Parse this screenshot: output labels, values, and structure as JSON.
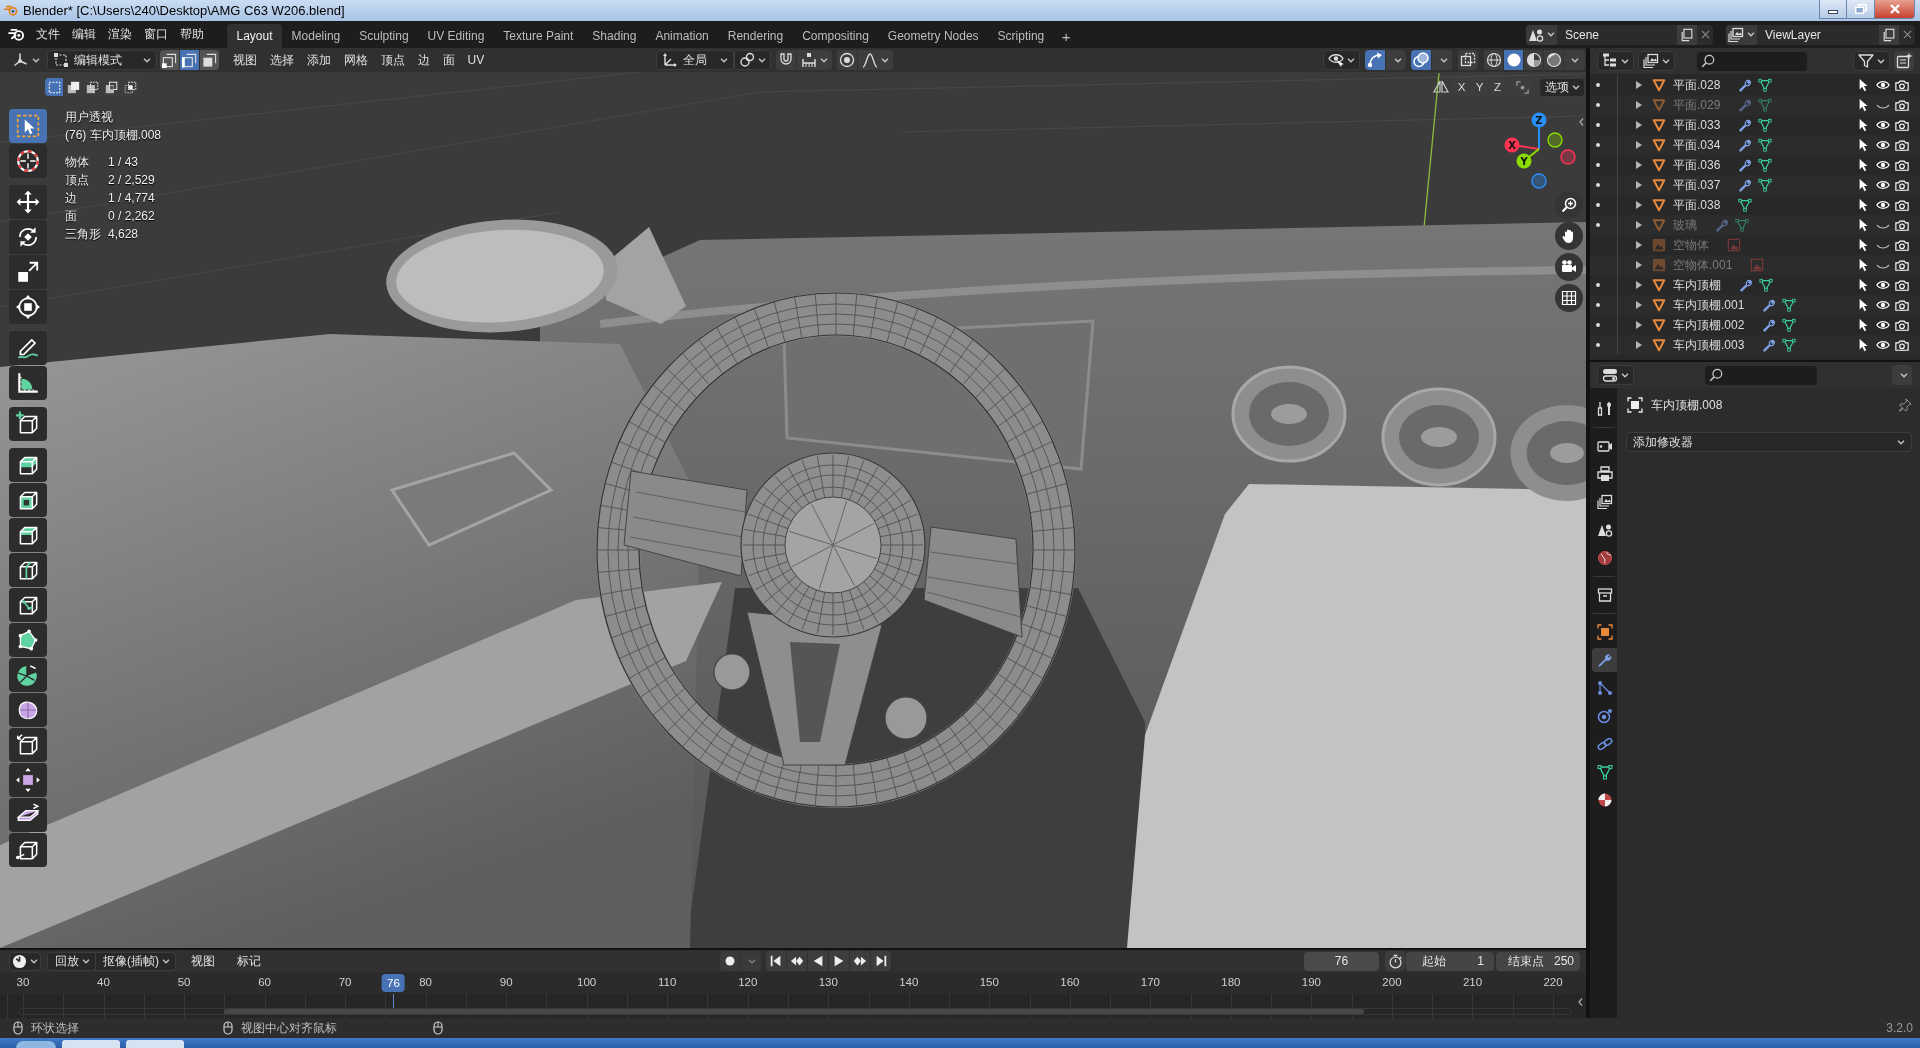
{
  "window": {
    "title": "Blender* [C:\\Users\\240\\Desktop\\AMG C63 W206.blend]"
  },
  "menu_bar": [
    "文件",
    "编辑",
    "渲染",
    "窗口",
    "帮助"
  ],
  "workspace_tabs": [
    {
      "label": "Layout",
      "selected": true
    },
    {
      "label": "Modeling",
      "selected": false
    },
    {
      "label": "Sculpting",
      "selected": false
    },
    {
      "label": "UV Editing",
      "selected": false
    },
    {
      "label": "Texture Paint",
      "selected": false
    },
    {
      "label": "Shading",
      "selected": false
    },
    {
      "label": "Animation",
      "selected": false
    },
    {
      "label": "Rendering",
      "selected": false
    },
    {
      "label": "Compositing",
      "selected": false
    },
    {
      "label": "Geometry Nodes",
      "selected": false
    },
    {
      "label": "Scripting",
      "selected": false
    }
  ],
  "add_workspace": "+",
  "scene": {
    "name": "Scene"
  },
  "view_layer": {
    "name": "ViewLayer"
  },
  "viewport_header": {
    "mode": "编辑模式",
    "select_modes": [
      {
        "kind": "vertex",
        "selected": false
      },
      {
        "kind": "edge",
        "selected": true
      },
      {
        "kind": "face",
        "selected": false
      }
    ],
    "menus": [
      "视图",
      "选择",
      "添加",
      "网格",
      "顶点",
      "边",
      "面",
      "UV"
    ],
    "orientation": "全局",
    "gizmos_on": true,
    "overlays_on": true,
    "shading_modes": [
      {
        "kind": "wireframe",
        "selected": false
      },
      {
        "kind": "solid",
        "selected": true
      },
      {
        "kind": "material",
        "selected": false
      },
      {
        "kind": "rendered",
        "selected": false
      }
    ]
  },
  "tool_settings": {
    "box_modes": [
      {
        "kind": "set",
        "selected": true
      },
      {
        "kind": "extend",
        "selected": false
      },
      {
        "kind": "subtract",
        "selected": false
      },
      {
        "kind": "invert",
        "selected": false
      },
      {
        "kind": "intersect",
        "selected": false
      }
    ],
    "mirror_axes": [
      "X",
      "Y",
      "Z"
    ],
    "options": "选项"
  },
  "viewport_info": {
    "view": "用户透视",
    "object": "(76) 车内顶棚.008",
    "stats": [
      {
        "label": "物体",
        "value": "1 / 43"
      },
      {
        "label": "顶点",
        "value": "2 / 2,529"
      },
      {
        "label": "边",
        "value": "1 / 4,774"
      },
      {
        "label": "面",
        "value": "0 / 2,262"
      },
      {
        "label": "三角形",
        "value": "4,628"
      }
    ]
  },
  "toolbar": [
    [
      {
        "kind": "select-box",
        "selected": true
      },
      {
        "kind": "cursor",
        "selected": false
      }
    ],
    [
      {
        "kind": "move",
        "selected": false
      },
      {
        "kind": "rotate",
        "selected": false
      },
      {
        "kind": "scale",
        "selected": false
      },
      {
        "kind": "transform",
        "selected": false
      }
    ],
    [
      {
        "kind": "annotate",
        "selected": false
      },
      {
        "kind": "measure",
        "selected": false
      }
    ],
    [
      {
        "kind": "add-cube",
        "selected": false
      }
    ],
    [
      {
        "kind": "extrude",
        "selected": false
      },
      {
        "kind": "inset",
        "selected": false
      },
      {
        "kind": "bevel",
        "selected": false
      },
      {
        "kind": "loop-cut",
        "selected": false
      },
      {
        "kind": "knife",
        "selected": false
      },
      {
        "kind": "poly-build",
        "selected": false
      },
      {
        "kind": "spin",
        "selected": false
      },
      {
        "kind": "smooth",
        "selected": false
      },
      {
        "kind": "edge-slide",
        "selected": false
      },
      {
        "kind": "shrink-fatten",
        "selected": false
      },
      {
        "kind": "shear",
        "selected": false
      },
      {
        "kind": "rip",
        "selected": false
      }
    ]
  ],
  "nav_gizmo": {
    "axes": [
      {
        "label": "Z",
        "color": "#2890ff"
      },
      {
        "label": "X",
        "color": "#ff3352"
      },
      {
        "label": "Y",
        "color": "#8bdc00"
      }
    ]
  },
  "outliner": {
    "rows": [
      {
        "name": "平面.028",
        "kind": "mesh",
        "edit_mode": true,
        "modifier": true,
        "visible": true
      },
      {
        "name": "平面.029",
        "kind": "mesh",
        "edit_mode": true,
        "modifier": true,
        "visible": false
      },
      {
        "name": "平面.033",
        "kind": "mesh",
        "edit_mode": true,
        "modifier": true,
        "visible": true
      },
      {
        "name": "平面.034",
        "kind": "mesh",
        "edit_mode": true,
        "modifier": true,
        "visible": true
      },
      {
        "name": "平面.036",
        "kind": "mesh",
        "edit_mode": true,
        "modifier": true,
        "visible": true
      },
      {
        "name": "平面.037",
        "kind": "mesh",
        "edit_mode": true,
        "modifier": true,
        "visible": true
      },
      {
        "name": "平面.038",
        "kind": "mesh",
        "edit_mode": true,
        "modifier": false,
        "visible": true
      },
      {
        "name": "玻璃",
        "kind": "mesh",
        "edit_mode": true,
        "modifier": true,
        "visible": false
      },
      {
        "name": "空物体",
        "kind": "empty",
        "edit_mode": false,
        "modifier": false,
        "visible": false
      },
      {
        "name": "空物体.001",
        "kind": "empty",
        "edit_mode": false,
        "modifier": false,
        "visible": false
      },
      {
        "name": "车内顶棚",
        "kind": "mesh",
        "edit_mode": true,
        "modifier": true,
        "visible": true
      },
      {
        "name": "车内顶棚.001",
        "kind": "mesh",
        "edit_mode": true,
        "modifier": true,
        "visible": true
      },
      {
        "name": "车内顶棚.002",
        "kind": "mesh",
        "edit_mode": true,
        "modifier": true,
        "visible": true
      },
      {
        "name": "车内顶棚.003",
        "kind": "mesh",
        "edit_mode": true,
        "modifier": true,
        "visible": true
      }
    ]
  },
  "properties": {
    "tab_groups": [
      [
        {
          "kind": "tool",
          "selected": false
        }
      ],
      [
        {
          "kind": "render",
          "selected": false
        },
        {
          "kind": "output",
          "selected": false
        },
        {
          "kind": "view-layer",
          "selected": false
        },
        {
          "kind": "scene",
          "selected": false
        },
        {
          "kind": "world",
          "selected": false
        }
      ],
      [
        {
          "kind": "collection",
          "selected": false
        }
      ],
      [
        {
          "kind": "object",
          "selected": false
        },
        {
          "kind": "modifiers",
          "selected": true
        },
        {
          "kind": "particles",
          "selected": false
        },
        {
          "kind": "physics",
          "selected": false
        },
        {
          "kind": "constraints",
          "selected": false
        },
        {
          "kind": "data",
          "selected": false
        },
        {
          "kind": "material",
          "selected": false
        }
      ]
    ],
    "object_name": "车内顶棚.008",
    "add_modifier": "添加修改器"
  },
  "timeline": {
    "menus": [
      {
        "label": "回放",
        "kind": "dropdown"
      },
      {
        "label": "抠像(插帧)",
        "kind": "dropdown"
      },
      {
        "label": "视图",
        "kind": "menu"
      },
      {
        "label": "标记",
        "kind": "menu"
      }
    ],
    "current_frame": "76",
    "start_label": "起始",
    "start": "1",
    "end_label": "结束点",
    "end": "250",
    "ticks": [
      "30",
      "40",
      "50",
      "60",
      "70",
      "80",
      "90",
      "100",
      "110",
      "120",
      "130",
      "140",
      "150",
      "160",
      "170",
      "180",
      "190",
      "200",
      "210",
      "220"
    ],
    "playhead": {
      "label": "76",
      "level": 0.2421
    }
  },
  "status_bar": {
    "hints": [
      "环状选择",
      "视图中心对齐鼠标"
    ],
    "version": "3.2.0"
  }
}
